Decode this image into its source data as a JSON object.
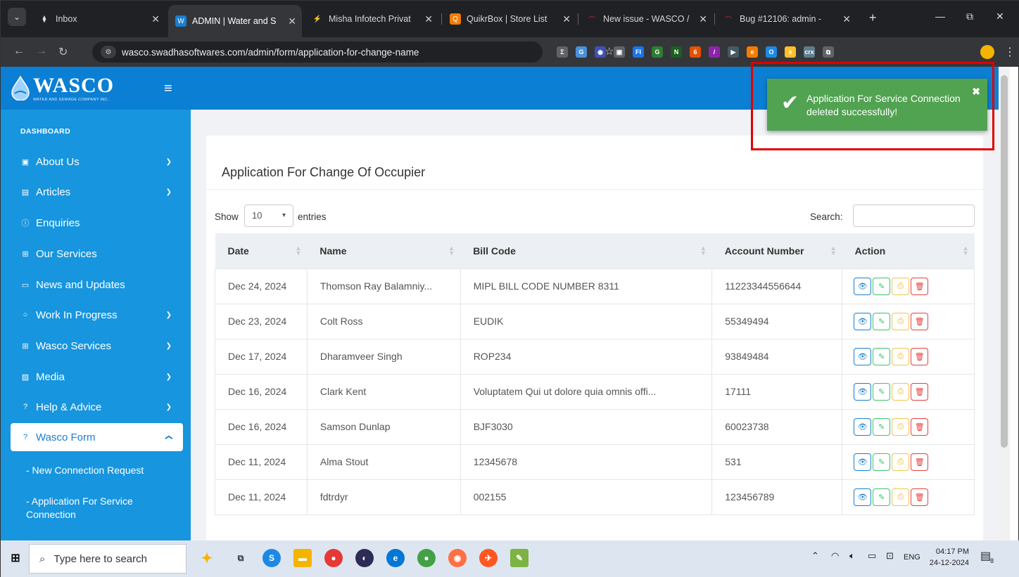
{
  "browser": {
    "tabs": [
      {
        "title": "Inbox",
        "favicon": "dropbox-icon",
        "color": "#3c3d40"
      },
      {
        "title": "ADMIN | Water and S",
        "favicon": "wasco-icon",
        "color": "#1b7fd0"
      },
      {
        "title": "Misha Infotech Privat",
        "favicon": "misha-icon",
        "color": "#e53e3e"
      },
      {
        "title": "QuikrBox | Store List",
        "favicon": "quikrbox-icon",
        "color": "#f57c00"
      },
      {
        "title": "New issue - WASCO /",
        "favicon": "redmine-icon",
        "color": "#c62828"
      },
      {
        "title": "Bug #12106: admin -",
        "favicon": "redmine-icon",
        "color": "#c62828"
      }
    ],
    "url": "wasco.swadhasoftwares.com/admin/form/application-for-change-name",
    "extensions": [
      {
        "label": "Σ",
        "color": "#5f6368"
      },
      {
        "label": "G",
        "color": "#4a90d9"
      },
      {
        "label": "◉",
        "color": "#3f51b5"
      },
      {
        "label": "▣",
        "color": "#5f6368"
      },
      {
        "label": "FI",
        "color": "#1a73e8"
      },
      {
        "label": "G",
        "color": "#2e7d32"
      },
      {
        "label": "N",
        "color": "#1b5e20"
      },
      {
        "label": "6",
        "color": "#e65100"
      },
      {
        "label": "/",
        "color": "#8e24aa"
      },
      {
        "label": "▶",
        "color": "#455a64"
      },
      {
        "label": "e",
        "color": "#f57c00"
      },
      {
        "label": "O",
        "color": "#1e88e5"
      },
      {
        "label": "x",
        "color": "#fbc02d"
      },
      {
        "label": "crx",
        "color": "#607d8b"
      },
      {
        "label": "⧉",
        "color": "#5f6368"
      }
    ]
  },
  "app": {
    "logo_text": "WASCO",
    "logo_subtext": "WATER AND SEWAGE COMPANY INC.",
    "accent": "#0b7fd3",
    "sidebar_color": "#1795de"
  },
  "sidebar": {
    "heading": "DASHBOARD",
    "items": [
      {
        "label": "About Us",
        "icon": "building-icon",
        "chevron": "⌄"
      },
      {
        "label": "Articles",
        "icon": "article-icon",
        "chevron": "⌄"
      },
      {
        "label": "Enquiries",
        "icon": "info-icon",
        "chevron": ""
      },
      {
        "label": "Our Services",
        "icon": "grid-icon",
        "chevron": ""
      },
      {
        "label": "News and Updates",
        "icon": "newspaper-icon",
        "chevron": ""
      },
      {
        "label": "Work In Progress",
        "icon": "circle-icon",
        "chevron": "⌄"
      },
      {
        "label": "Wasco Services",
        "icon": "grid-icon",
        "chevron": "⌄"
      },
      {
        "label": "Media",
        "icon": "image-icon",
        "chevron": "⌄"
      },
      {
        "label": "Help & Advice",
        "icon": "question-icon",
        "chevron": "⌄"
      },
      {
        "label": "Wasco Form",
        "icon": "question-icon",
        "chevron": "⌃"
      }
    ],
    "subitems": [
      {
        "label": "- New Connection Request"
      },
      {
        "label": "- Application For Service Connection"
      }
    ]
  },
  "main": {
    "title": "Application For Change Of Occupier",
    "show_label": "Show",
    "entries_value": "10",
    "entries_label": "entries",
    "search_label": "Search:",
    "search_value": "",
    "columns": [
      "Date",
      "Name",
      "Bill Code",
      "Account Number",
      "Action"
    ],
    "rows": [
      {
        "date": "Dec 24, 2024",
        "name": "Thomson Ray Balamniy...",
        "bill_code": "MIPL BILL CODE NUMBER 8311",
        "account": "11223344556644"
      },
      {
        "date": "Dec 23, 2024",
        "name": "Colt Ross",
        "bill_code": "EUDIK",
        "account": "55349494"
      },
      {
        "date": "Dec 17, 2024",
        "name": "Dharamveer Singh",
        "bill_code": "ROP234",
        "account": "93849484"
      },
      {
        "date": "Dec 16, 2024",
        "name": "Clark Kent",
        "bill_code": "Voluptatem Qui ut dolore quia omnis offi...",
        "account": "17111"
      },
      {
        "date": "Dec 16, 2024",
        "name": "Samson Dunlap",
        "bill_code": "BJF3030",
        "account": "60023738"
      },
      {
        "date": "Dec 11, 2024",
        "name": "Alma Stout",
        "bill_code": "12345678",
        "account": "531"
      },
      {
        "date": "Dec 11, 2024",
        "name": "fdtrdyr",
        "bill_code": "002155",
        "account": "123456789"
      }
    ]
  },
  "toast": {
    "message": "Application For Service Connection deleted successfully!",
    "color": "#51a351"
  },
  "taskbar": {
    "search_placeholder": "Type here to search",
    "language": "ENG",
    "time": "04:17 PM",
    "date": "24-12-2024",
    "notification_count": "8"
  }
}
